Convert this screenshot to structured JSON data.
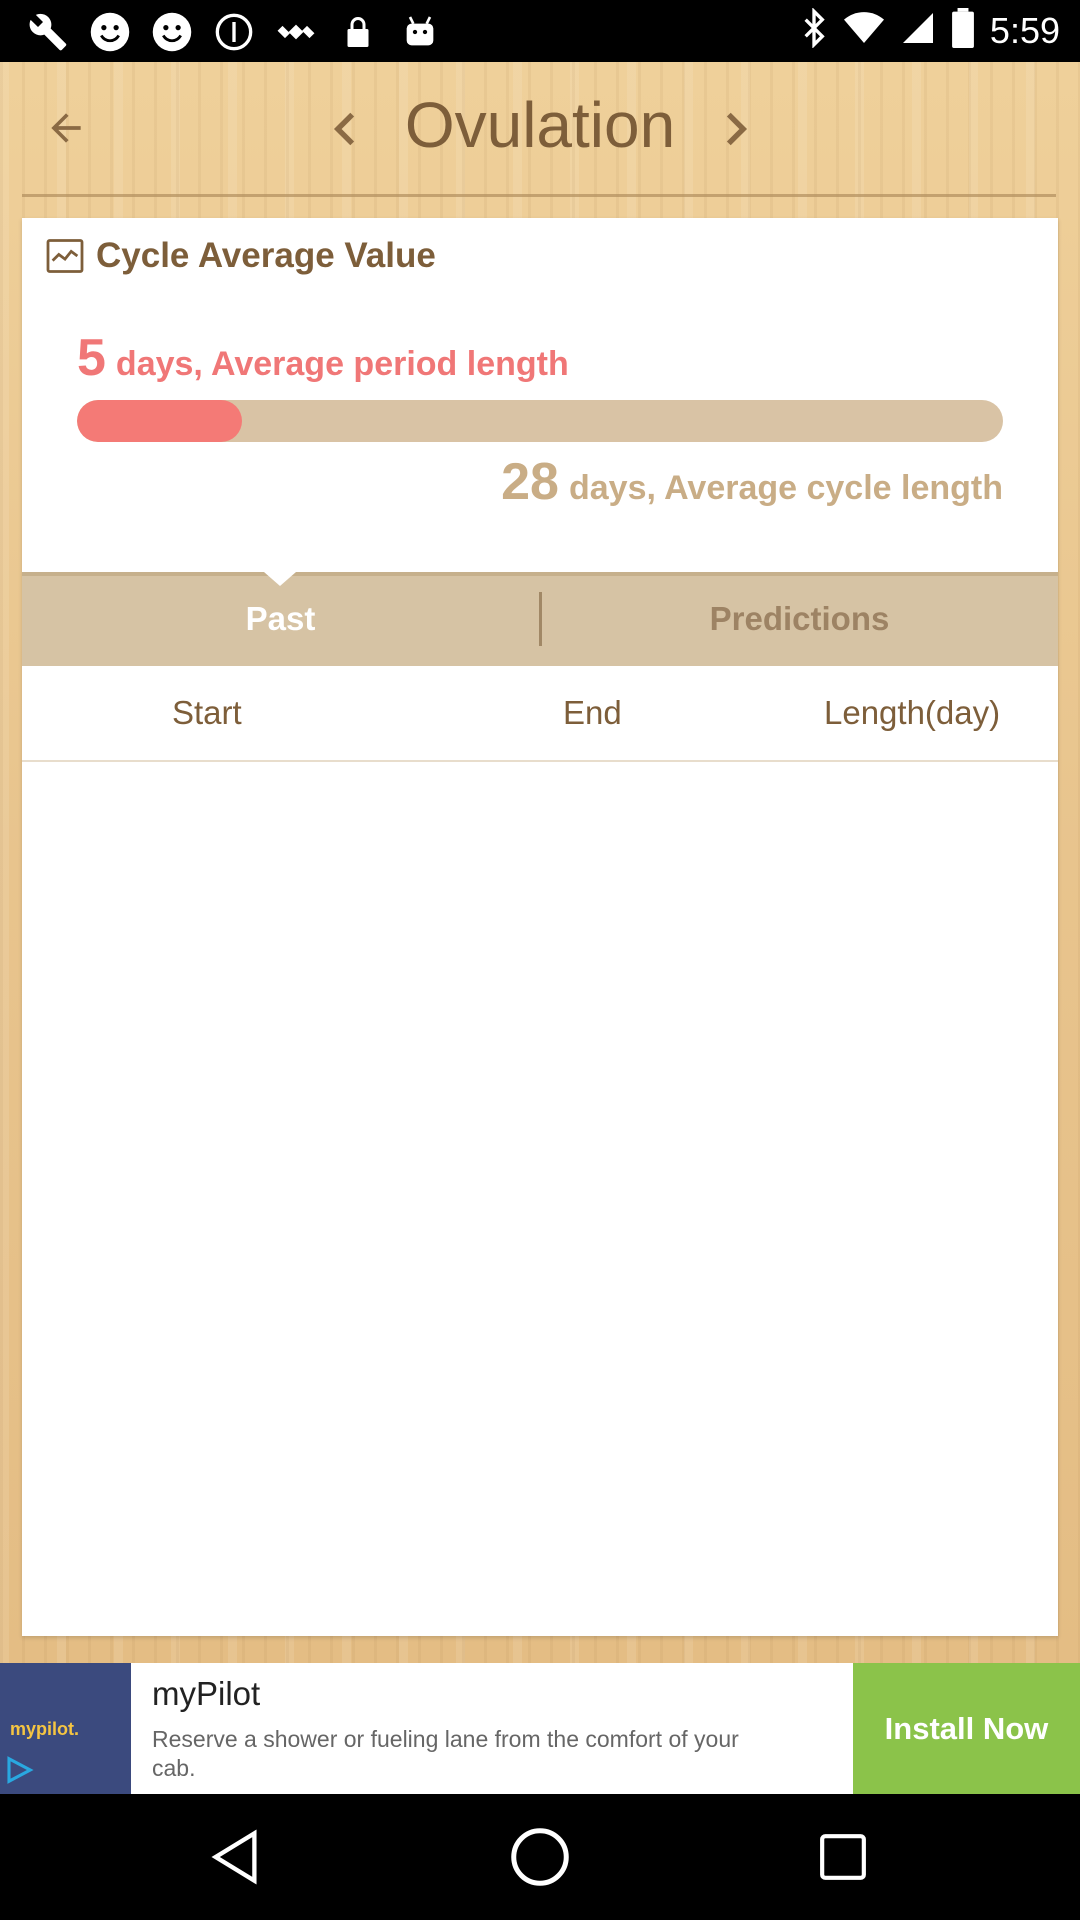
{
  "status_bar": {
    "time": "5:59",
    "icons": [
      "wrench-icon",
      "smiley-icon",
      "smiley-icon",
      "info-icon",
      "satellite-icon",
      "lock-icon",
      "android-icon",
      "bluetooth-icon",
      "wifi-icon",
      "signal-icon",
      "battery-icon"
    ]
  },
  "header": {
    "title": "Ovulation"
  },
  "card": {
    "title": "Cycle Average Value",
    "period_value": "5",
    "period_label": "days, Average period length",
    "period_fraction": 0.1786,
    "cycle_value": "28",
    "cycle_label": "days, Average cycle length"
  },
  "tabs": [
    {
      "label": "Past",
      "active": true
    },
    {
      "label": "Predictions",
      "active": false
    }
  ],
  "table": {
    "columns": [
      "Start",
      "End",
      "Length(day)"
    ],
    "rows": []
  },
  "ad": {
    "logo_text": "mypilot.",
    "title": "myPilot",
    "description": "Reserve a shower or fueling lane from the comfort of your cab.",
    "cta": "Install Now"
  },
  "colors": {
    "accent_red": "#f47a76",
    "tan": "#c9ad86",
    "brown_text": "#7d5e3a",
    "install_green": "#8bc34a"
  }
}
